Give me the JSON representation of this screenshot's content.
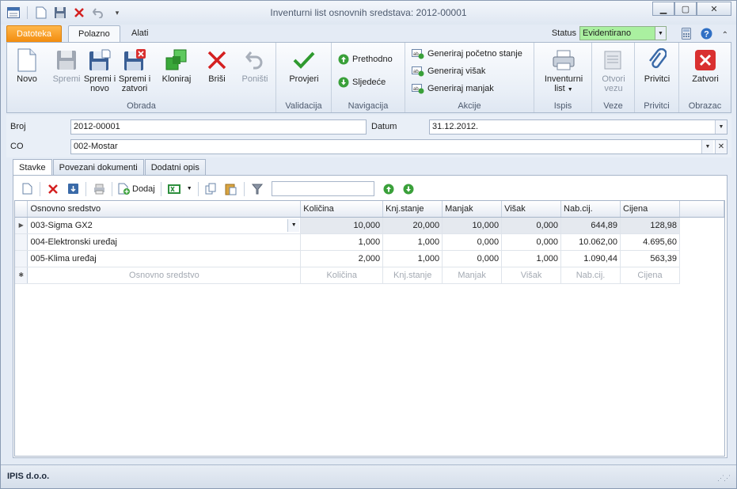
{
  "window": {
    "title": "Inventurni list osnovnih sredstava: 2012-00001",
    "minimize": "▁",
    "maximize": "▢",
    "close": "✕"
  },
  "ribbon_tabs": {
    "file": "Datoteka",
    "home": "Polazno",
    "tools": "Alati"
  },
  "status": {
    "label": "Status",
    "value": "Evidentirano"
  },
  "groups": {
    "obrada": {
      "label": "Obrada",
      "novo": "Novo",
      "spremi": "Spremi",
      "spremi_novo": "Spremi i novo",
      "spremi_zatvori": "Spremi i zatvori",
      "kloniraj": "Kloniraj",
      "brisi": "Briši",
      "ponisti": "Poništi"
    },
    "validacija": {
      "label": "Validacija",
      "provjeri": "Provjeri"
    },
    "navigacija": {
      "label": "Navigacija",
      "prethodno": "Prethodno",
      "sljedece": "Sljedeće"
    },
    "akcije": {
      "label": "Akcije",
      "pocetno": "Generiraj početno stanje",
      "visak": "Generiraj višak",
      "manjak": "Generiraj manjak"
    },
    "ispis": {
      "label": "Ispis",
      "inventurni": "Inventurni list"
    },
    "veze": {
      "label": "Veze",
      "otvori": "Otvori vezu"
    },
    "privitci": {
      "label": "Privitci",
      "privitci": "Privitci"
    },
    "obrazac": {
      "label": "Obrazac",
      "zatvori": "Zatvori"
    }
  },
  "form": {
    "broj_label": "Broj",
    "broj_value": "2012-00001",
    "datum_label": "Datum",
    "datum_value": "31.12.2012.",
    "co_label": "CO",
    "co_value": "002-Mostar"
  },
  "doc_tabs": [
    "Stavke",
    "Povezani dokumenti",
    "Dodatni opis"
  ],
  "grid_toolbar": {
    "dodaj": "Dodaj"
  },
  "grid": {
    "columns": [
      "Osnovno sredstvo",
      "Količina",
      "Knj.stanje",
      "Manjak",
      "Višak",
      "Nab.cij.",
      "Cijena"
    ],
    "rows": [
      [
        "003-Sigma GX2",
        "10,000",
        "20,000",
        "10,000",
        "0,000",
        "644,89",
        "128,98"
      ],
      [
        "004-Elektronski uređaj",
        "1,000",
        "1,000",
        "0,000",
        "0,000",
        "10.062,00",
        "4.695,60"
      ],
      [
        "005-Klima uređaj",
        "2,000",
        "1,000",
        "0,000",
        "1,000",
        "1.090,44",
        "563,39"
      ]
    ],
    "new_row": [
      "Osnovno sredstvo",
      "Količina",
      "Knj.stanje",
      "Manjak",
      "Višak",
      "Nab.cij.",
      "Cijena"
    ]
  },
  "footer": {
    "company": "IPIS d.o.o."
  }
}
